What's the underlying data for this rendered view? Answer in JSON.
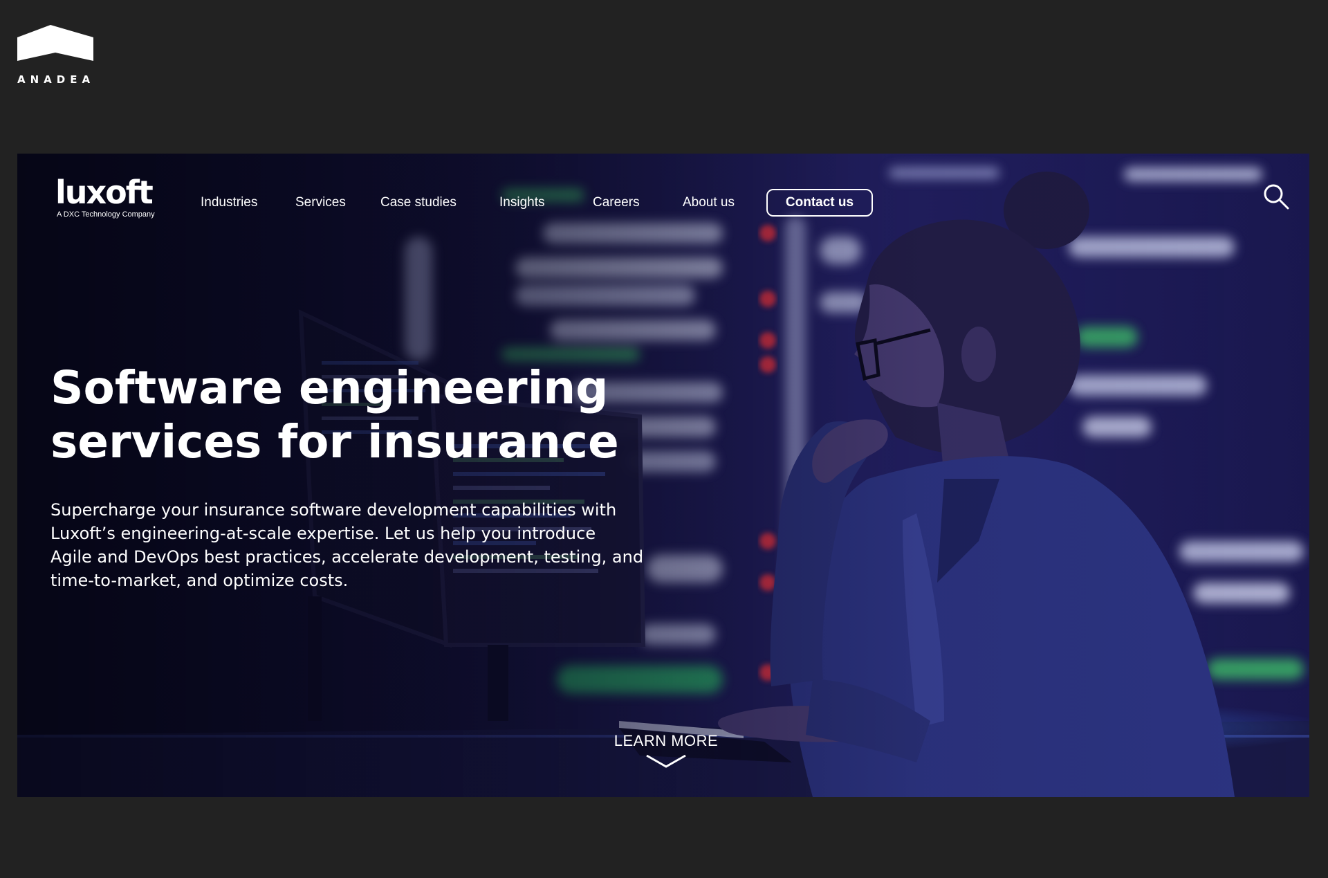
{
  "brand": {
    "name": "ANADEA"
  },
  "site": {
    "logo_text": "luxoft",
    "logo_tagline": "A DXC Technology Company"
  },
  "nav": {
    "items": [
      {
        "label": "Industries"
      },
      {
        "label": "Services"
      },
      {
        "label": "Case studies"
      },
      {
        "label": "Insights"
      },
      {
        "label": "Careers"
      },
      {
        "label": "About us"
      }
    ],
    "contact_label": "Contact us",
    "search_icon": "search-icon"
  },
  "hero": {
    "title_line1": "Software engineering",
    "title_line2": "services for insurance",
    "description_line1": "Supercharge your insurance software development capabilities with",
    "description_line2": "Luxoft’s engineering-at-scale expertise. Let us help you introduce",
    "description_line3": "Agile and DevOps best practices, accelerate development, testing, and",
    "description_line4": "time-to-market, and optimize costs.",
    "learn_more_label": "LEARN MORE",
    "learn_more_icon": "chevron-down-icon"
  },
  "colors": {
    "page_background": "#222222",
    "hero_tint": "#1c1a5a",
    "text": "#ffffff"
  }
}
